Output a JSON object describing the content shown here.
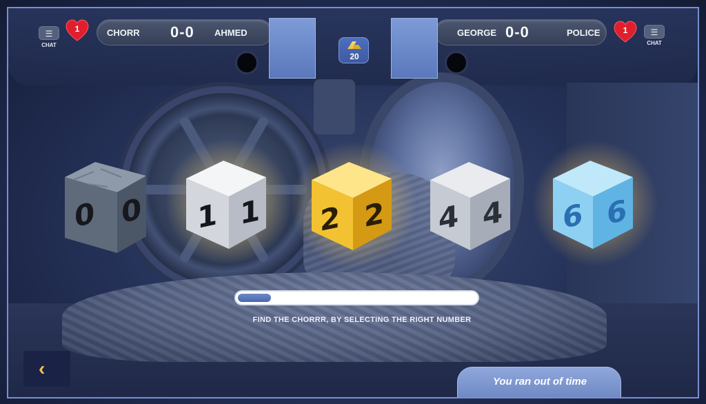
{
  "hud": {
    "left": {
      "chat_label": "CHAT",
      "lives": "1",
      "player1_name": "CHORR",
      "score": "0-0",
      "player2_name": "AHMED"
    },
    "right": {
      "chat_label": "CHAT",
      "lives": "1",
      "player1_name": "GEORGE",
      "score": "0-0",
      "player2_name": "POLICE"
    },
    "gold_count": "20"
  },
  "cubes": [
    {
      "number": "0",
      "material": "stone",
      "glow": false
    },
    {
      "number": "1",
      "material": "silver",
      "glow": true
    },
    {
      "number": "2",
      "material": "gold",
      "glow": true
    },
    {
      "number": "4",
      "material": "silver",
      "glow": false
    },
    {
      "number": "6",
      "material": "ice",
      "glow": true
    }
  ],
  "progress": {
    "fraction": 0.14
  },
  "instruction": "FIND THE CHORRR, BY SELECTING THE RIGHT NUMBER",
  "back_icon": "chevron-left-icon",
  "timeout_message": "You ran out of time",
  "colors": {
    "accent_gold": "#f2c44a",
    "heart_red": "#e01f2e",
    "avatar_blue": "#6f8fd0"
  }
}
